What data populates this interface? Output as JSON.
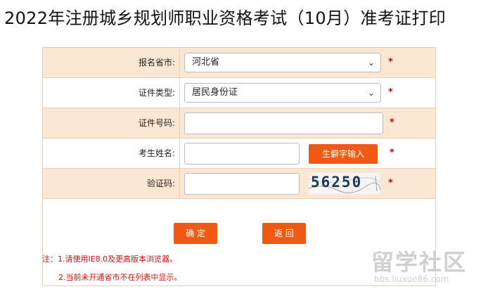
{
  "page": {
    "title": "2022年注册城乡规划师职业资格考试（10月）准考证打印"
  },
  "form": {
    "province": {
      "label": "报名省市:",
      "value": "河北省",
      "required_mark": "*"
    },
    "id_type": {
      "label": "证件类型:",
      "value": "居民身份证",
      "required_mark": "*"
    },
    "id_number": {
      "label": "证件号码:",
      "value": "",
      "required_mark": "*"
    },
    "name": {
      "label": "考生姓名:",
      "value": "",
      "rare_char_button": "生僻字输入",
      "required_mark": "*"
    },
    "captcha": {
      "label": "验证码:",
      "value": "",
      "image_text": "56250",
      "required_mark": "*"
    },
    "confirm_button": "确 定",
    "back_button": "返 回"
  },
  "notes": {
    "line1": "注：1.请使用IE8.0及更高版本浏览器。",
    "line2": "2.当前未开通省市不在列表中显示。"
  },
  "watermark": {
    "logo_text": "留学社区",
    "url": "bbs.liuxue86.com"
  },
  "colors": {
    "accent_button": "#f15a14",
    "row_tint": "#fbe6d2",
    "required": "#d40000",
    "notes": "#cc1010"
  },
  "icons": {
    "select_arrow": "chevron-down-icon"
  }
}
